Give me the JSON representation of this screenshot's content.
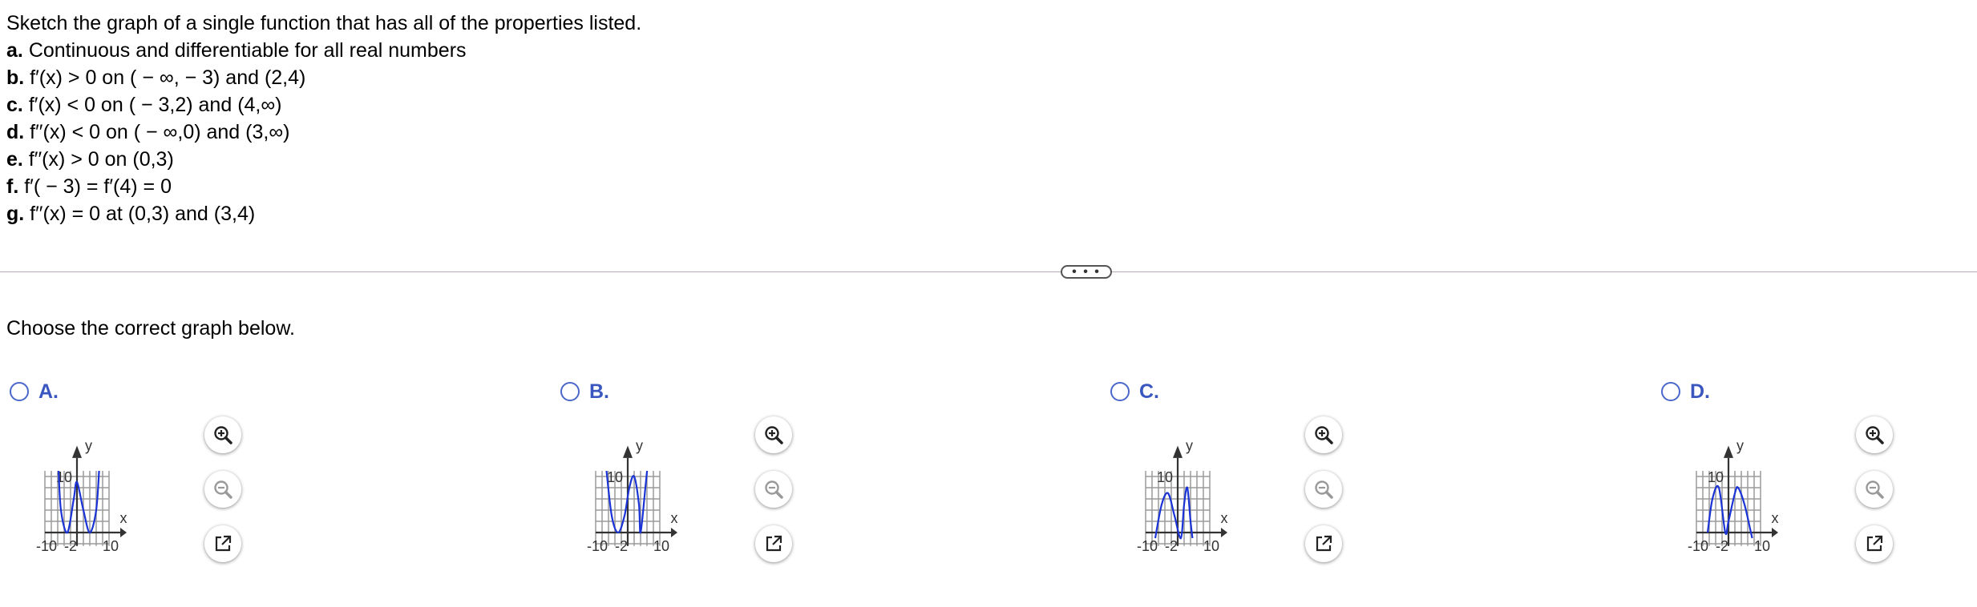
{
  "question": {
    "intro": "Sketch the graph of a single function that has all of the properties listed.",
    "items": [
      {
        "letter": "a.",
        "text": "Continuous and differentiable for all real numbers"
      },
      {
        "letter": "b.",
        "text": "f′(x) > 0 on ( − ∞, − 3) and (2,4)"
      },
      {
        "letter": "c.",
        "text": "f′(x) < 0 on ( − 3,2) and (4,∞)"
      },
      {
        "letter": "d.",
        "text": "f′′(x) < 0 on ( − ∞,0) and (3,∞)"
      },
      {
        "letter": "e.",
        "text": "f′′(x) > 0 on (0,3)"
      },
      {
        "letter": "f.",
        "text": "f′( − 3) = f′(4) = 0"
      },
      {
        "letter": "g.",
        "text": "f′′(x) = 0 at (0,3) and (3,4)"
      }
    ]
  },
  "expand_button": "• • •",
  "prompt": "Choose the correct graph below.",
  "accent_color": "#3a57c0",
  "curve_color": "#1a33d6",
  "graph_labels": {
    "y": "y",
    "x": "x",
    "xmin": "-10",
    "xtick": "-2",
    "xmax": "10",
    "ymax": "10"
  },
  "choices": [
    {
      "label": "A.",
      "icons": [
        "zoom-in-icon",
        "zoom-out-icon",
        "open-new-window-icon"
      ],
      "curve_points": [
        [
          -5.8,
          12
        ],
        [
          -5,
          4
        ],
        [
          -3,
          0
        ],
        [
          -1,
          6
        ],
        [
          0,
          9
        ],
        [
          2,
          4
        ],
        [
          4,
          0
        ],
        [
          6,
          4
        ],
        [
          7,
          12
        ]
      ]
    },
    {
      "label": "B.",
      "icons": [
        "zoom-in-icon",
        "zoom-out-icon",
        "open-new-window-icon"
      ],
      "curve_points": [
        [
          -6.8,
          12
        ],
        [
          -5,
          3
        ],
        [
          -3,
          0
        ],
        [
          -1,
          3
        ],
        [
          0.5,
          8
        ],
        [
          2,
          10
        ],
        [
          3.5,
          5
        ],
        [
          4,
          0
        ],
        [
          5.5,
          8
        ],
        [
          6.2,
          12
        ]
      ]
    },
    {
      "label": "C.",
      "icons": [
        "zoom-in-icon",
        "zoom-out-icon",
        "open-new-window-icon"
      ],
      "curve_points": [
        [
          -7,
          -1
        ],
        [
          -5,
          5
        ],
        [
          -3,
          7
        ],
        [
          -1,
          3
        ],
        [
          1,
          -1
        ],
        [
          2,
          5
        ],
        [
          3,
          8
        ],
        [
          4,
          2
        ],
        [
          4.6,
          -1
        ]
      ]
    },
    {
      "label": "D.",
      "icons": [
        "zoom-in-icon",
        "zoom-out-icon",
        "open-new-window-icon"
      ],
      "curve_points": [
        [
          -6.5,
          0
        ],
        [
          -5,
          6
        ],
        [
          -3,
          8
        ],
        [
          -1,
          0
        ],
        [
          0,
          2
        ],
        [
          2,
          7
        ],
        [
          3,
          8
        ],
        [
          5,
          5
        ],
        [
          7,
          0
        ],
        [
          7.4,
          -1
        ]
      ]
    }
  ]
}
